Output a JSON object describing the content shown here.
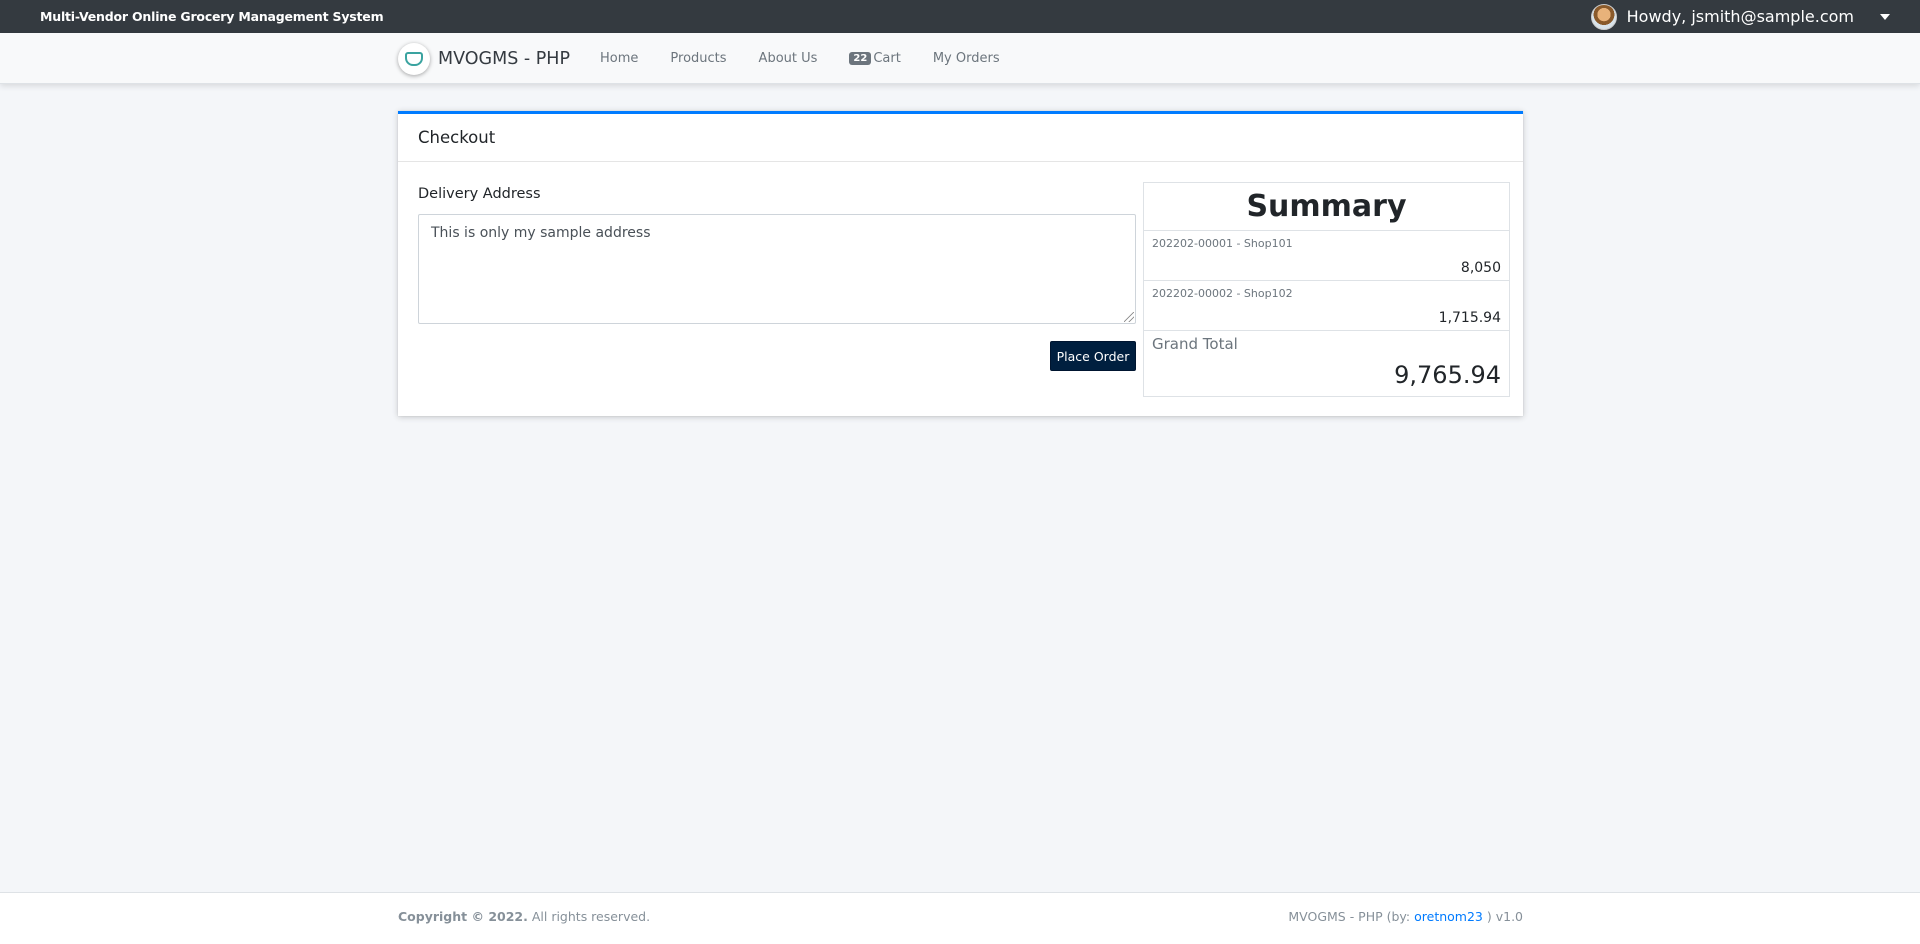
{
  "topbar": {
    "system_title": "Multi-Vendor Online Grocery Management System",
    "greeting": "Howdy, jsmith@sample.com"
  },
  "navbar": {
    "brand": "MVOGMS - PHP",
    "links": {
      "home": "Home",
      "products": "Products",
      "about": "About Us",
      "cart": "Cart",
      "orders": "My Orders"
    },
    "cart_count": "22"
  },
  "checkout": {
    "title": "Checkout",
    "address_label": "Delivery Address",
    "address_value": "This is only my sample address",
    "place_order_label": "Place Order"
  },
  "summary": {
    "title": "Summary",
    "items": [
      {
        "code": "202202-00001 - Shop101",
        "amount": "8,050"
      },
      {
        "code": "202202-00002 - Shop102",
        "amount": "1,715.94"
      }
    ],
    "grand_total_label": "Grand Total",
    "grand_total": "9,765.94"
  },
  "footer": {
    "copyright_strong": "Copyright © 2022.",
    "copyright_rest": " All rights reserved.",
    "credit_prefix": "MVOGMS - PHP (by: ",
    "credit_author": "oretnom23",
    "credit_suffix": " ) v1.0"
  }
}
